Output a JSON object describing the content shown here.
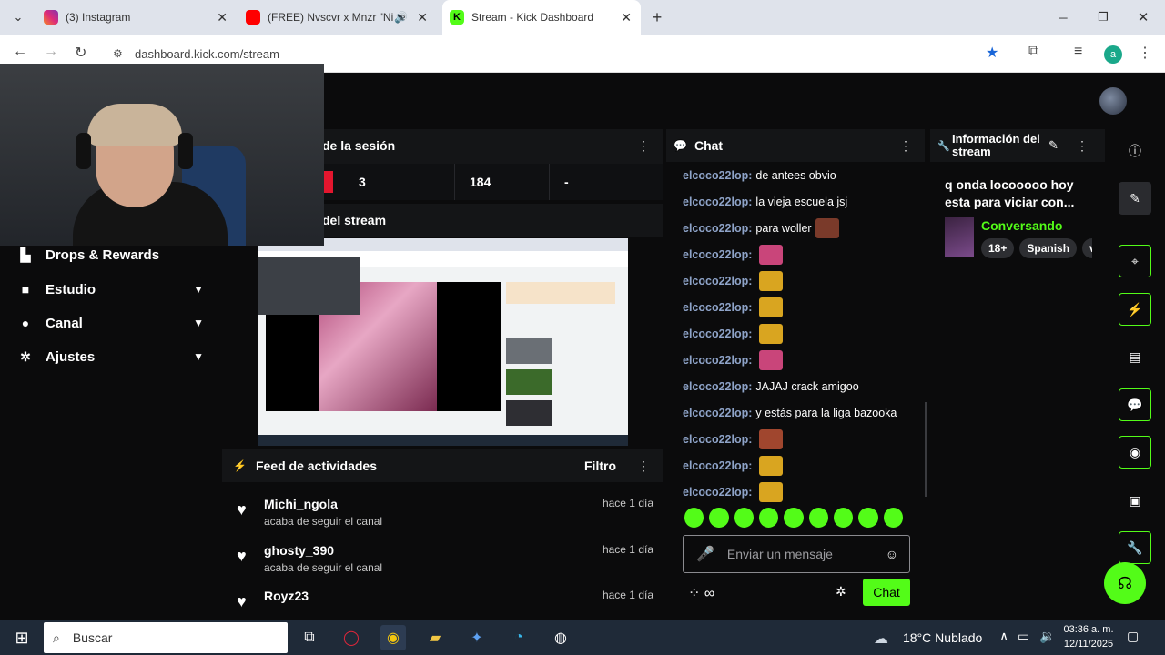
{
  "browser": {
    "tabs": [
      {
        "title": "(3) Instagram",
        "color": "#e1306c"
      },
      {
        "title": "(FREE) Nvscvr x Mnzr \"Ni te",
        "color": "#ff0000"
      },
      {
        "title": "Stream - Kick Dashboard",
        "color": "#53fc18"
      }
    ],
    "new_tab": "+",
    "url": "dashboard.kick.com/stream",
    "profile_initial": "a"
  },
  "sidebar": {
    "items": [
      {
        "label": "Drops & Rewards",
        "icon": "chart-icon"
      },
      {
        "label": "Estudio",
        "icon": "video-icon"
      },
      {
        "label": "Canal",
        "icon": "person-icon"
      },
      {
        "label": "Ajustes",
        "icon": "gear-icon"
      }
    ]
  },
  "session": {
    "title": "de la sesión",
    "stats": [
      "3",
      "184",
      "-"
    ]
  },
  "preview": {
    "title": "del stream"
  },
  "chat": {
    "title": "Chat",
    "messages": [
      {
        "user": "elcoco22lop:",
        "text": "de antees obvio"
      },
      {
        "user": "elcoco22lop:",
        "text": "la vieja escuela jsj"
      },
      {
        "user": "elcoco22lop:",
        "text": "para woller",
        "sticker": "#7a3a2a"
      },
      {
        "user": "elcoco22lop:",
        "text": "",
        "sticker": "#c9457a"
      },
      {
        "user": "elcoco22lop:",
        "text": "",
        "sticker": "#d9a520"
      },
      {
        "user": "elcoco22lop:",
        "text": "",
        "sticker": "#d9a520"
      },
      {
        "user": "elcoco22lop:",
        "text": "",
        "sticker": "#d9a520"
      },
      {
        "user": "elcoco22lop:",
        "text": "",
        "sticker": "#c9457a"
      },
      {
        "user": "elcoco22lop:",
        "text": "JAJAJ crack amigoo"
      },
      {
        "user": "elcoco22lop:",
        "text": "y estás para la liga bazooka"
      },
      {
        "user": "elcoco22lop:",
        "text": "",
        "sticker": "#a0462e"
      },
      {
        "user": "elcoco22lop:",
        "text": "",
        "sticker": "#d9a520"
      },
      {
        "user": "elcoco22lop:",
        "text": "",
        "sticker": "#d9a520"
      }
    ],
    "placeholder": "Enviar un mensaje",
    "send_label": "Chat"
  },
  "info": {
    "title": "Información del stream",
    "stream_title": "q onda locooooo hoy esta para viciar con...",
    "category": "Conversando",
    "tags": [
      "18+",
      "Spanish",
      "v"
    ]
  },
  "feed": {
    "title": "Feed de actividades",
    "filter_label": "Filtro",
    "items": [
      {
        "name": "Michi_ngola",
        "action": "acaba de seguir el canal",
        "time": "hace 1 día"
      },
      {
        "name": "ghosty_390",
        "action": "acaba de seguir el canal",
        "time": "hace 1 día"
      },
      {
        "name": "Royz23",
        "action": "",
        "time": "hace 1 día"
      }
    ]
  },
  "taskbar": {
    "search": "Buscar",
    "weather": "18°C  Nublado",
    "time": "03:36 a. m.",
    "date": "12/11/2025"
  },
  "colors": {
    "accent": "#53fc18",
    "username": "#8ea3c8"
  }
}
